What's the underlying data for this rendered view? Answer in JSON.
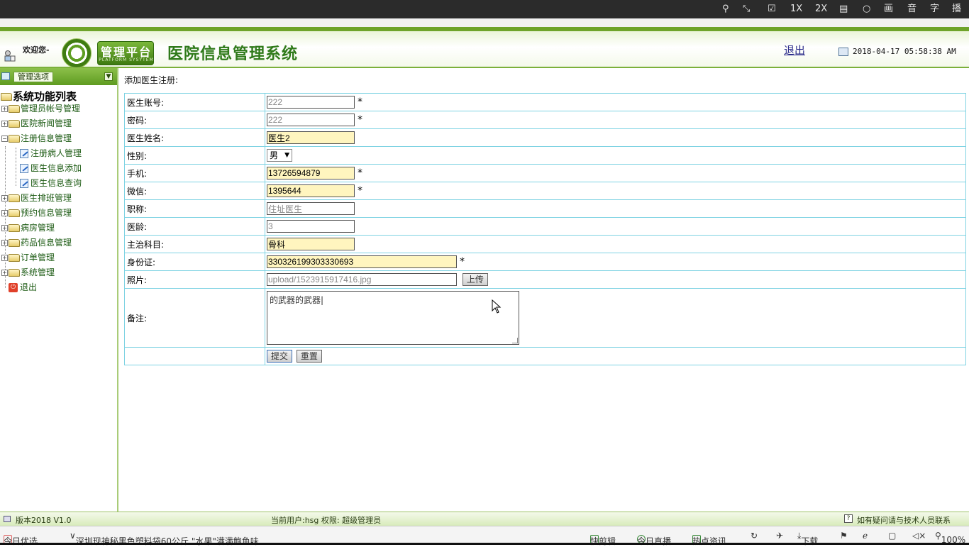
{
  "player_bar": {
    "items": [
      "1X",
      "2X",
      "画",
      "音",
      "字",
      "播"
    ]
  },
  "header": {
    "welcome": "欢迎您-",
    "logo_title": "管理平台",
    "logo_subtitle": "PLATFORM SYSYTEM",
    "system_title": "医院信息管理系统",
    "logout": "退出",
    "datetime": "2018-04-17 05:58:38 AM"
  },
  "sidebar": {
    "head_button": "管理选项",
    "root": "系统功能列表",
    "items": [
      {
        "label": "管理员帐号管理",
        "type": "folder",
        "toggle": "+"
      },
      {
        "label": "医院新闻管理",
        "type": "folder",
        "toggle": "+"
      },
      {
        "label": "注册信息管理",
        "type": "folder",
        "toggle": "−"
      },
      {
        "label": "注册病人管理",
        "type": "doc"
      },
      {
        "label": "医生信息添加",
        "type": "doc"
      },
      {
        "label": "医生信息查询",
        "type": "doc"
      },
      {
        "label": "医生排班管理",
        "type": "folder",
        "toggle": "+"
      },
      {
        "label": "预约信息管理",
        "type": "folder",
        "toggle": "+"
      },
      {
        "label": "病房管理",
        "type": "folder",
        "toggle": "+"
      },
      {
        "label": "药品信息管理",
        "type": "folder",
        "toggle": "+"
      },
      {
        "label": "订单管理",
        "type": "folder",
        "toggle": "+"
      },
      {
        "label": "系统管理",
        "type": "folder",
        "toggle": "+"
      },
      {
        "label": "退出",
        "type": "exit"
      }
    ]
  },
  "form": {
    "caption": "添加医生注册:",
    "fields": {
      "account": {
        "label": "医生账号:",
        "value": "222",
        "required": "*"
      },
      "password": {
        "label": "密码:",
        "value": "222",
        "required": "*"
      },
      "name": {
        "label": "医生姓名:",
        "value": "医生2"
      },
      "gender": {
        "label": "性别:",
        "value": "男"
      },
      "phone": {
        "label": "手机:",
        "value": "13726594879",
        "required": "*"
      },
      "wechat": {
        "label": "微信:",
        "value": "1395644",
        "required": "*"
      },
      "title": {
        "label": "职称:",
        "value": "住址医生"
      },
      "experience": {
        "label": "医龄:",
        "value": "3"
      },
      "specialty": {
        "label": "主治科目:",
        "value": "骨科"
      },
      "idcard": {
        "label": "身份证:",
        "value": "330326199303330693",
        "required": "*"
      },
      "photo": {
        "label": "照片:",
        "value": "upload/1523915917416.jpg",
        "upload_button": "上传"
      },
      "remark": {
        "label": "备注:",
        "value": "的武器的武器|"
      }
    },
    "submit": "提交",
    "reset": "重置"
  },
  "status_bar": {
    "version": "版本2018 V1.0",
    "current_user": "当前用户:hsg 权限:  超级管理员",
    "help": "如有疑问请与技术人员联系"
  },
  "browser_bottom": {
    "left": "今日优选",
    "news": "深圳现神秘黑色塑料袋60公斤 \"水果\"满满鲍鱼味",
    "items": [
      "快剪辑",
      "今日直播",
      "热点资讯",
      "下载"
    ],
    "zoom": "100%"
  },
  "colors": {
    "header_green": "#2f7a1a",
    "field_highlight": "#fff5bf",
    "table_border": "#7fd3e3"
  }
}
